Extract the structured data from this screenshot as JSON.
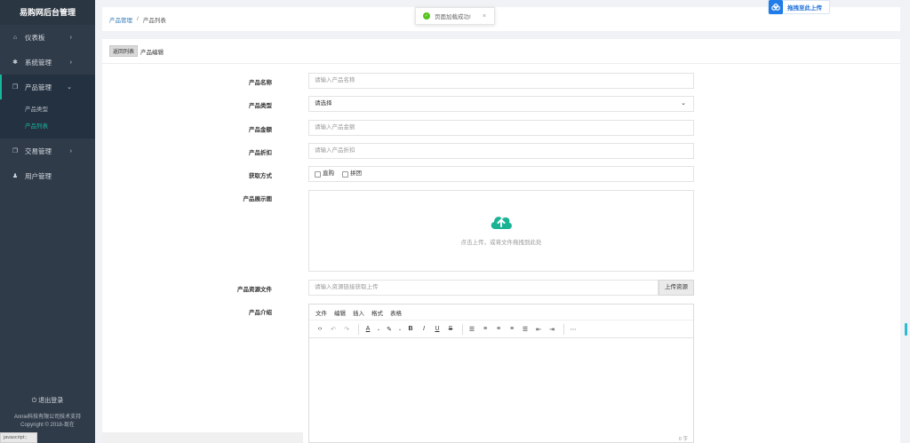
{
  "sidebar": {
    "brand": "易购网后台管理",
    "items": [
      {
        "label": "仪表板",
        "icon": "home-icon",
        "glyph": "⌂",
        "expanded": false
      },
      {
        "label": "系统管理",
        "icon": "gear-icon",
        "glyph": "✱",
        "expanded": false
      },
      {
        "label": "产品管理",
        "icon": "cube-icon",
        "glyph": "❒",
        "expanded": true
      },
      {
        "label": "交易管理",
        "icon": "copy-icon",
        "glyph": "❐",
        "expanded": false
      },
      {
        "label": "用户管理",
        "icon": "user-icon",
        "glyph": "♟",
        "expanded": false
      }
    ],
    "subitems": [
      {
        "label": "产品类型",
        "active": false
      },
      {
        "label": "产品列表",
        "active": true
      }
    ],
    "logout": "退出登录",
    "footer_line1": "Annie科技有限公司技术支持",
    "footer_line2": "Copyright © 2018-现在",
    "status": "javascript:;"
  },
  "breadcrumb": {
    "link": "产品管理",
    "separator": "/",
    "current": "产品列表"
  },
  "toast": {
    "message": "页面加载成功!",
    "close": "×"
  },
  "upload_badge": "拖拽至此上传",
  "panel": {
    "back_label": "返回列表",
    "title": "产品编辑"
  },
  "form": {
    "name": {
      "label": "产品名称",
      "placeholder": "请输入产品名称"
    },
    "type": {
      "label": "产品类型",
      "value": "请选择"
    },
    "amount": {
      "label": "产品金额",
      "placeholder": "请输入产品金额"
    },
    "discount": {
      "label": "产品折扣",
      "placeholder": "请输入产品折扣"
    },
    "method": {
      "label": "获取方式",
      "options": [
        "直购",
        "拼团"
      ]
    },
    "image": {
      "label": "产品展示图",
      "hint": "点击上传，或将文件拖拽到此处"
    },
    "resource": {
      "label": "产品资源文件",
      "placeholder": "请输入资源链接获取上传",
      "button": "上传资源"
    },
    "intro": {
      "label": "产品介绍"
    }
  },
  "editor": {
    "menus": [
      "文件",
      "编辑",
      "插入",
      "格式",
      "表格"
    ],
    "word_count": "0 字"
  },
  "colors": {
    "accent": "#18b69b",
    "sidebar_bg": "#2f3b49",
    "link": "#337ab7",
    "upload_icon": "#1ab394"
  }
}
